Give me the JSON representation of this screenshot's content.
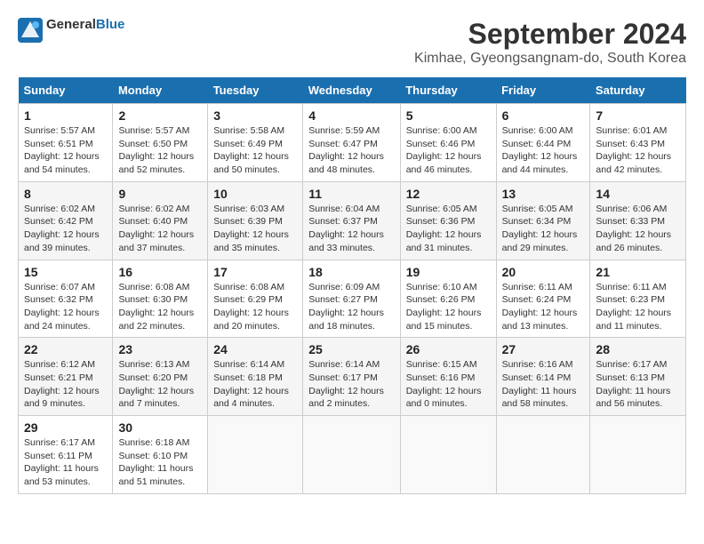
{
  "header": {
    "logo_line1": "General",
    "logo_line2": "Blue",
    "title": "September 2024",
    "subtitle": "Kimhae, Gyeongsangnam-do, South Korea"
  },
  "days_of_week": [
    "Sunday",
    "Monday",
    "Tuesday",
    "Wednesday",
    "Thursday",
    "Friday",
    "Saturday"
  ],
  "weeks": [
    [
      {
        "num": "1",
        "rise": "5:57 AM",
        "set": "6:51 PM",
        "daylight": "12 hours and 54 minutes."
      },
      {
        "num": "2",
        "rise": "5:57 AM",
        "set": "6:50 PM",
        "daylight": "12 hours and 52 minutes."
      },
      {
        "num": "3",
        "rise": "5:58 AM",
        "set": "6:49 PM",
        "daylight": "12 hours and 50 minutes."
      },
      {
        "num": "4",
        "rise": "5:59 AM",
        "set": "6:47 PM",
        "daylight": "12 hours and 48 minutes."
      },
      {
        "num": "5",
        "rise": "6:00 AM",
        "set": "6:46 PM",
        "daylight": "12 hours and 46 minutes."
      },
      {
        "num": "6",
        "rise": "6:00 AM",
        "set": "6:44 PM",
        "daylight": "12 hours and 44 minutes."
      },
      {
        "num": "7",
        "rise": "6:01 AM",
        "set": "6:43 PM",
        "daylight": "12 hours and 42 minutes."
      }
    ],
    [
      {
        "num": "8",
        "rise": "6:02 AM",
        "set": "6:42 PM",
        "daylight": "12 hours and 39 minutes."
      },
      {
        "num": "9",
        "rise": "6:02 AM",
        "set": "6:40 PM",
        "daylight": "12 hours and 37 minutes."
      },
      {
        "num": "10",
        "rise": "6:03 AM",
        "set": "6:39 PM",
        "daylight": "12 hours and 35 minutes."
      },
      {
        "num": "11",
        "rise": "6:04 AM",
        "set": "6:37 PM",
        "daylight": "12 hours and 33 minutes."
      },
      {
        "num": "12",
        "rise": "6:05 AM",
        "set": "6:36 PM",
        "daylight": "12 hours and 31 minutes."
      },
      {
        "num": "13",
        "rise": "6:05 AM",
        "set": "6:34 PM",
        "daylight": "12 hours and 29 minutes."
      },
      {
        "num": "14",
        "rise": "6:06 AM",
        "set": "6:33 PM",
        "daylight": "12 hours and 26 minutes."
      }
    ],
    [
      {
        "num": "15",
        "rise": "6:07 AM",
        "set": "6:32 PM",
        "daylight": "12 hours and 24 minutes."
      },
      {
        "num": "16",
        "rise": "6:08 AM",
        "set": "6:30 PM",
        "daylight": "12 hours and 22 minutes."
      },
      {
        "num": "17",
        "rise": "6:08 AM",
        "set": "6:29 PM",
        "daylight": "12 hours and 20 minutes."
      },
      {
        "num": "18",
        "rise": "6:09 AM",
        "set": "6:27 PM",
        "daylight": "12 hours and 18 minutes."
      },
      {
        "num": "19",
        "rise": "6:10 AM",
        "set": "6:26 PM",
        "daylight": "12 hours and 15 minutes."
      },
      {
        "num": "20",
        "rise": "6:11 AM",
        "set": "6:24 PM",
        "daylight": "12 hours and 13 minutes."
      },
      {
        "num": "21",
        "rise": "6:11 AM",
        "set": "6:23 PM",
        "daylight": "12 hours and 11 minutes."
      }
    ],
    [
      {
        "num": "22",
        "rise": "6:12 AM",
        "set": "6:21 PM",
        "daylight": "12 hours and 9 minutes."
      },
      {
        "num": "23",
        "rise": "6:13 AM",
        "set": "6:20 PM",
        "daylight": "12 hours and 7 minutes."
      },
      {
        "num": "24",
        "rise": "6:14 AM",
        "set": "6:18 PM",
        "daylight": "12 hours and 4 minutes."
      },
      {
        "num": "25",
        "rise": "6:14 AM",
        "set": "6:17 PM",
        "daylight": "12 hours and 2 minutes."
      },
      {
        "num": "26",
        "rise": "6:15 AM",
        "set": "6:16 PM",
        "daylight": "12 hours and 0 minutes."
      },
      {
        "num": "27",
        "rise": "6:16 AM",
        "set": "6:14 PM",
        "daylight": "11 hours and 58 minutes."
      },
      {
        "num": "28",
        "rise": "6:17 AM",
        "set": "6:13 PM",
        "daylight": "11 hours and 56 minutes."
      }
    ],
    [
      {
        "num": "29",
        "rise": "6:17 AM",
        "set": "6:11 PM",
        "daylight": "11 hours and 53 minutes."
      },
      {
        "num": "30",
        "rise": "6:18 AM",
        "set": "6:10 PM",
        "daylight": "11 hours and 51 minutes."
      },
      null,
      null,
      null,
      null,
      null
    ]
  ]
}
